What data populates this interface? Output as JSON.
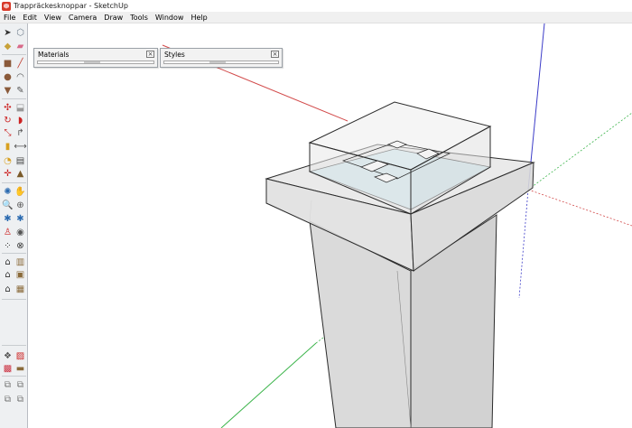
{
  "window": {
    "title": "Trappräckesknoppar - SketchUp"
  },
  "menu": [
    "File",
    "Edit",
    "View",
    "Camera",
    "Draw",
    "Tools",
    "Window",
    "Help"
  ],
  "panels": {
    "materials": {
      "title": "Materials",
      "close_glyph": "×"
    },
    "styles": {
      "title": "Styles",
      "close_glyph": "×"
    }
  },
  "tools": [
    {
      "name": "select-tool-icon",
      "glyph": "➤",
      "color": "#333333"
    },
    {
      "name": "make-component-icon",
      "glyph": "⬡",
      "color": "#6f7d8c"
    },
    {
      "name": "paint-bucket-icon",
      "glyph": "◆",
      "color": "#c8a23a"
    },
    {
      "name": "eraser-icon",
      "glyph": "▰",
      "color": "#d86a8a"
    },
    {
      "name": "rectangle-icon",
      "glyph": "■",
      "color": "#8a5a3a"
    },
    {
      "name": "line-icon",
      "glyph": "╱",
      "color": "#c0392b"
    },
    {
      "name": "circle-icon",
      "glyph": "●",
      "color": "#8a5a3a"
    },
    {
      "name": "arc-icon",
      "glyph": "◠",
      "color": "#555555"
    },
    {
      "name": "polygon-icon",
      "glyph": "▼",
      "color": "#8a5a3a"
    },
    {
      "name": "freehand-icon",
      "glyph": "✎",
      "color": "#555555"
    },
    {
      "name": "move-icon",
      "glyph": "✣",
      "color": "#cc2222"
    },
    {
      "name": "push-pull-icon",
      "glyph": "⬓",
      "color": "#999999"
    },
    {
      "name": "rotate-icon",
      "glyph": "↻",
      "color": "#cc2222"
    },
    {
      "name": "follow-me-icon",
      "glyph": "◗",
      "color": "#cc2222"
    },
    {
      "name": "scale-icon",
      "glyph": "⤡",
      "color": "#cc2222"
    },
    {
      "name": "offset-icon",
      "glyph": "↱",
      "color": "#555555"
    },
    {
      "name": "tape-measure-icon",
      "glyph": "▮",
      "color": "#d8a020"
    },
    {
      "name": "dimension-icon",
      "glyph": "⟷",
      "color": "#555555"
    },
    {
      "name": "protractor-icon",
      "glyph": "◔",
      "color": "#d8a020"
    },
    {
      "name": "text-icon",
      "glyph": "▤",
      "color": "#444444"
    },
    {
      "name": "axes-icon",
      "glyph": "✛",
      "color": "#cc2222"
    },
    {
      "name": "3d-text-icon",
      "glyph": "▲",
      "color": "#7a5a2a"
    },
    {
      "name": "orbit-icon",
      "glyph": "✺",
      "color": "#2a6ab0"
    },
    {
      "name": "pan-icon",
      "glyph": "✋",
      "color": "#555555"
    },
    {
      "name": "zoom-icon",
      "glyph": "🔍",
      "color": "#2a6ab0"
    },
    {
      "name": "zoom-window-icon",
      "glyph": "⊕",
      "color": "#555555"
    },
    {
      "name": "zoom-extents-icon",
      "glyph": "✱",
      "color": "#2a6ab0"
    },
    {
      "name": "previous-view-icon",
      "glyph": "✱",
      "color": "#2a6ab0"
    },
    {
      "name": "position-camera-icon",
      "glyph": "♙",
      "color": "#cc2222"
    },
    {
      "name": "look-around-icon",
      "glyph": "◉",
      "color": "#555555"
    },
    {
      "name": "walk-icon",
      "glyph": "⁘",
      "color": "#333333"
    },
    {
      "name": "section-plane-icon",
      "glyph": "⊗",
      "color": "#333333"
    },
    {
      "name": "get-models-icon",
      "glyph": "⌂",
      "color": "#333333"
    },
    {
      "name": "share-model-icon",
      "glyph": "▥",
      "color": "#8a6a3a"
    },
    {
      "name": "share-component-icon",
      "glyph": "⌂",
      "color": "#333333"
    },
    {
      "name": "extension-warehouse-icon",
      "glyph": "▣",
      "color": "#8a6a3a"
    },
    {
      "name": "home-icon",
      "glyph": "⌂",
      "color": "#333333"
    },
    {
      "name": "layout-icon",
      "glyph": "▦",
      "color": "#8a6a3a"
    },
    {
      "name": "sandbox-from-contours-icon",
      "glyph": "❖",
      "color": "#555555"
    },
    {
      "name": "sandbox-from-scratch-icon",
      "glyph": "▨",
      "color": "#cc2222"
    },
    {
      "name": "smoove-icon",
      "glyph": "▩",
      "color": "#cc3344"
    },
    {
      "name": "stamp-icon",
      "glyph": "▬",
      "color": "#8a6a3a"
    },
    {
      "name": "drape-icon",
      "glyph": "⧉",
      "color": "#777777"
    },
    {
      "name": "add-detail-icon",
      "glyph": "⧉",
      "color": "#777777"
    },
    {
      "name": "flip-edge-icon",
      "glyph": "⧉",
      "color": "#777777"
    },
    {
      "name": "solid-tools-icon",
      "glyph": "⧉",
      "color": "#777777"
    }
  ],
  "colors": {
    "axis_red": "#d24a4a",
    "axis_green": "#3cb44b",
    "axis_blue": "#3c3cc8",
    "model_edge": "#2b2b2b",
    "face_gray": "#d8d8d8",
    "face_light": "#eaeaea",
    "glass_blue": "#cfe6ee"
  }
}
